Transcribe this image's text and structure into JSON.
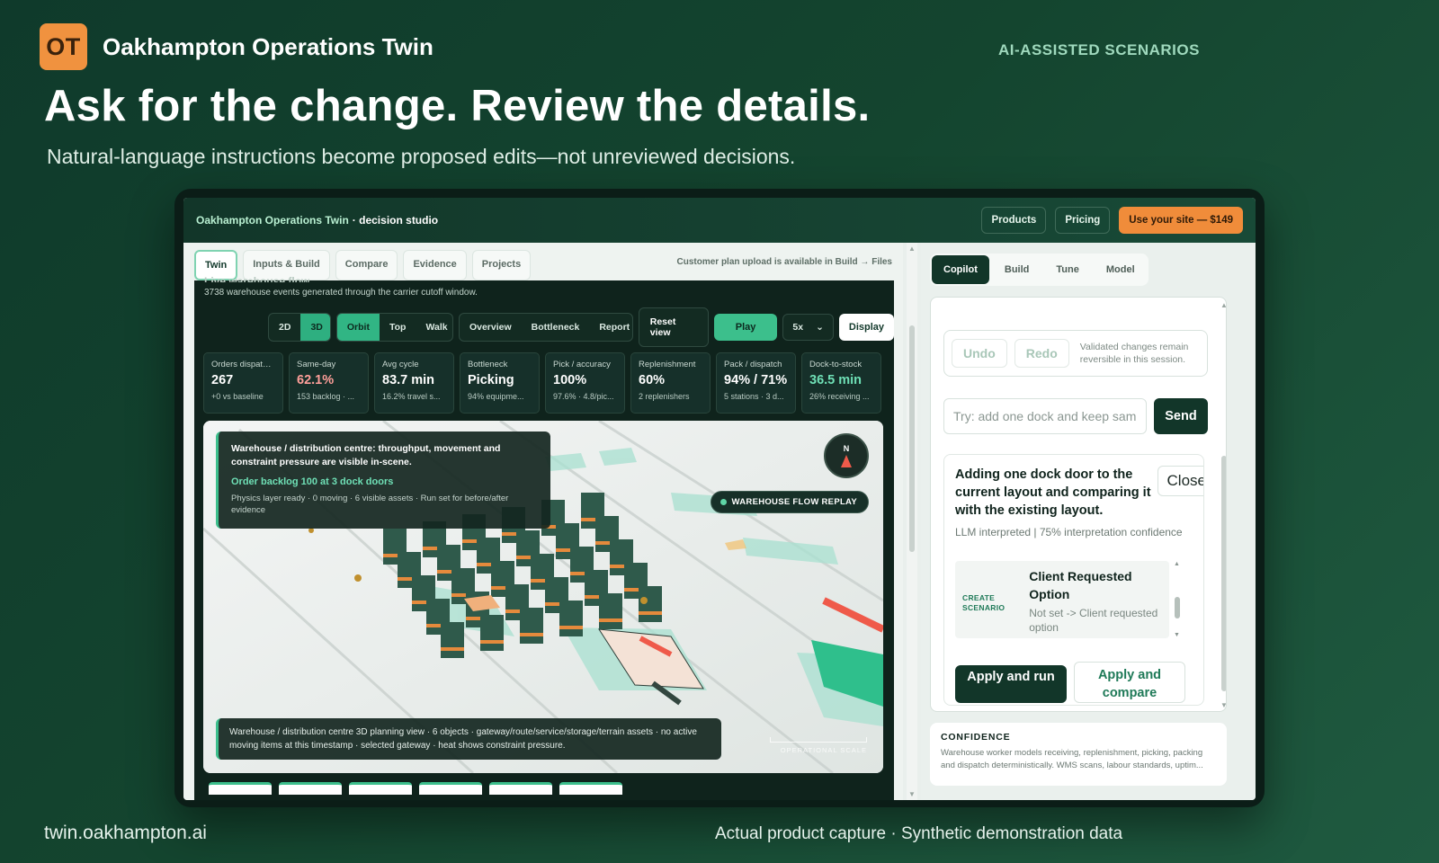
{
  "slide": {
    "brand_initials": "OT",
    "brand_name": "Oakhampton Operations Twin",
    "section_tag": "AI-ASSISTED SCENARIOS",
    "headline": "Ask for the change. Review the details.",
    "subhead": "Natural-language instructions become proposed edits—not unreviewed decisions.",
    "footer_left": "twin.oakhampton.ai",
    "footer_right": "Actual product capture · Synthetic demonstration data"
  },
  "app": {
    "title": "Oakhampton Operations Twin",
    "subtitle": "· decision studio",
    "top_actions": {
      "products": "Products",
      "pricing": "Pricing",
      "cta": "Use your site — $149"
    }
  },
  "nav": {
    "tabs": [
      "Twin",
      "Inputs & Build",
      "Compare",
      "Evidence",
      "Projects"
    ],
    "active": "Twin",
    "plan_note": "Customer plan upload is available in Build → Files"
  },
  "twin": {
    "caption_top": "Live warehouse flow",
    "caption": "3738 warehouse events generated through the carrier cutoff window.",
    "toolbar": {
      "views": [
        "2D",
        "3D"
      ],
      "camera": [
        "Orbit",
        "Top",
        "Walk"
      ],
      "panels": [
        "Overview",
        "Bottleneck",
        "Report"
      ],
      "reset": "Reset view",
      "play": "Play",
      "speed": "5x",
      "display": "Display"
    },
    "kpis": [
      {
        "label": "Orders dispatched",
        "value": "267",
        "sub": "+0 vs baseline",
        "tone": "normal"
      },
      {
        "label": "Same-day",
        "value": "62.1%",
        "sub": "153 backlog · ...",
        "tone": "warn"
      },
      {
        "label": "Avg cycle",
        "value": "83.7 min",
        "sub": "16.2% travel s...",
        "tone": "normal"
      },
      {
        "label": "Bottleneck",
        "value": "Picking",
        "sub": "94% equipme...",
        "tone": "normal"
      },
      {
        "label": "Pick / accuracy",
        "value": "100%",
        "sub": "97.6% · 4.8/pic...",
        "tone": "normal"
      },
      {
        "label": "Replenishment",
        "value": "60%",
        "sub": "2 replenishers",
        "tone": "normal"
      },
      {
        "label": "Pack / dispatch",
        "value": "94% / 71%",
        "sub": "5 stations · 3 d...",
        "tone": "normal"
      },
      {
        "label": "Dock-to-stock",
        "value": "36.5 min",
        "sub": "26% receiving ...",
        "tone": "good"
      }
    ],
    "overlay": {
      "title": "Warehouse / distribution centre: throughput, movement and constraint pressure are visible in-scene.",
      "alert": "Order backlog 100 at 3 dock doors",
      "meta": "Physics layer ready · 0 moving · 6 visible assets · Run set for before/after evidence"
    },
    "compass_label": "N",
    "replay_label": "WAREHOUSE FLOW REPLAY",
    "bottom_note": "Warehouse / distribution centre 3D planning view · 6 objects · gateway/route/service/storage/terrain assets · no active moving items at this timestamp · selected gateway · heat shows constraint pressure.",
    "scale_label": "OPERATIONAL SCALE"
  },
  "copilot": {
    "tabs": [
      "Copilot",
      "Build",
      "Tune",
      "Model"
    ],
    "active": "Copilot",
    "undo": "Undo",
    "redo": "Redo",
    "undo_note": "Validated changes remain reversible in this session.",
    "prompt_placeholder": "Try: add one dock and keep same",
    "send": "Send",
    "proposal": {
      "title": "Adding one dock door to the current layout and comparing it with the existing layout.",
      "close": "Close",
      "meta": "LLM interpreted | 75% interpretation confidence",
      "kind": "CREATE SCENARIO",
      "option_title": "Client Requested Option",
      "option_detail": "Not set -> Client requested option",
      "apply_run": "Apply and run",
      "apply_compare": "Apply and compare"
    },
    "confidence": {
      "title": "CONFIDENCE",
      "line1": "Warehouse worker models receiving, replenishment, picking, packing",
      "line2": "and dispatch deterministically. WMS scans, labour standards, uptim..."
    }
  },
  "colors": {
    "accent_orange": "#f08c3a",
    "accent_green": "#3cbf8c",
    "dark_green": "#123629",
    "warn": "#ff9f9a"
  }
}
